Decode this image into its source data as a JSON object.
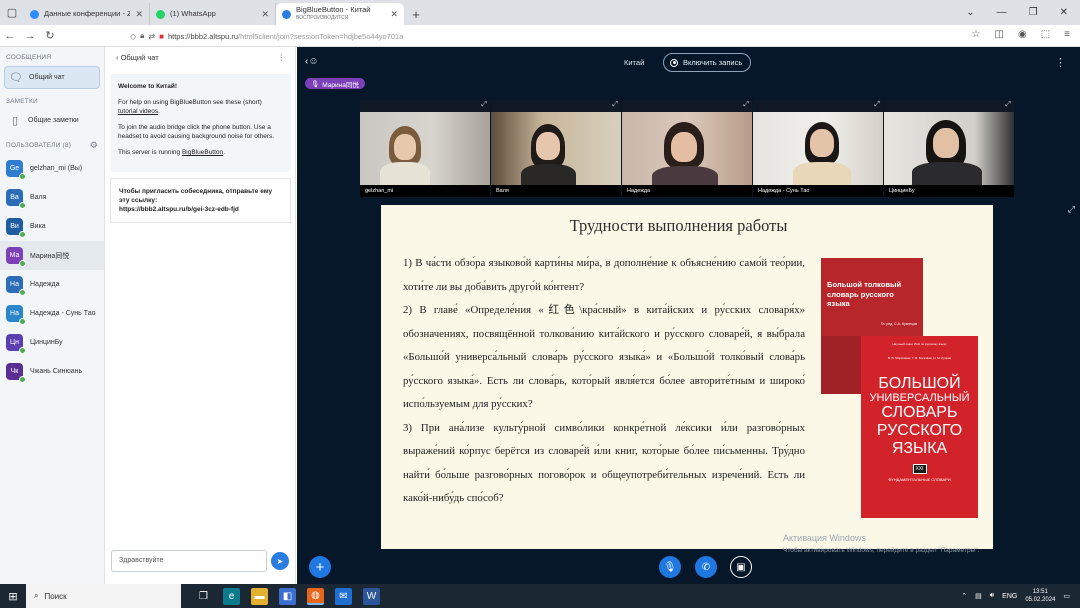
{
  "browser": {
    "tabs": [
      {
        "title": "Данные конференции - Zoom",
        "subtitle": "",
        "favicon_color": "#2d8cff"
      },
      {
        "title": "(1) WhatsApp",
        "subtitle": "",
        "favicon_color": "#25d366"
      },
      {
        "title": "BigBlueButton - Китай",
        "subtitle": "ВОСПРОИЗВОДИТСЯ",
        "favicon_color": "#2a7de1"
      }
    ],
    "url_host": "https://bbb2.altspu.ru",
    "url_path": "/html5client/join?sessionToken=hdjbe5o44yo701a"
  },
  "sidebar": {
    "messages_header": "СООБЩЕНИЯ",
    "public_chat": "Общий чат",
    "notes_header": "ЗАМЕТКИ",
    "shared_notes": "Общие заметки",
    "users_header": "ПОЛЬЗОВАТЕЛИ (8)",
    "users": [
      {
        "initials": "Ge",
        "name": "gelzhan_mi (Вы)",
        "color": "#2f7dd1",
        "me": false
      },
      {
        "initials": "Ва",
        "name": "Валя",
        "color": "#2c6db7",
        "me": false
      },
      {
        "initials": "Ви",
        "name": "Вика",
        "color": "#1f5d9e",
        "me": false
      },
      {
        "initials": "Ма",
        "name": "Марина同悦",
        "color": "#7b3fb8",
        "me": true
      },
      {
        "initials": "На",
        "name": "Надежда",
        "color": "#2c6db7",
        "me": false
      },
      {
        "initials": "На",
        "name": "Надежда - Сунь Тао",
        "color": "#2a86c8",
        "me": false
      },
      {
        "initials": "Цн",
        "name": "ЦинцинБу",
        "color": "#5a3fb0",
        "me": false
      },
      {
        "initials": "Чк",
        "name": "Чжань Синюань",
        "color": "#5b2f91",
        "me": false
      }
    ]
  },
  "chat": {
    "back_label": "Общий чат",
    "welcome_title": "Welcome to Китай!",
    "help_text_a": "For help on using BigBlueButton see these (short) ",
    "help_link": "tutorial videos",
    "help_text_b": ".",
    "audio_text": "To join the audio bridge click the phone button. Use a headset to avoid causing background noise for others.",
    "running_a": "This server is running ",
    "running_link": "BigBlueButton",
    "running_b": ".",
    "invite_text": "Чтобы пригласить собеседника, отправьте ему эту ссылку:",
    "invite_link": "https://bbb2.altspu.ru/b/gei-3cz-edb-fjd",
    "input_placeholder": "Здравствуйте"
  },
  "stage": {
    "room_name": "Китай",
    "record_label": "Включить запись",
    "talking": "Марина同悦",
    "videos": [
      {
        "name": "gelzhan_mi"
      },
      {
        "name": "Валя"
      },
      {
        "name": "Надежда"
      },
      {
        "name": "Надежда - Сунь Тао"
      },
      {
        "name": "ЦинцинБу"
      }
    ],
    "activation_title": "Активация Windows",
    "activation_text": "Чтобы активировать Windows, перейдите в раздел \"Параметры\"."
  },
  "slide": {
    "title": "Трудности выполнения работы",
    "paragraphs": [
      "1) В ча́сти обзо́ра языково́й карти́ны ми́ра, в дополне́ние к объясне́нию само́й тео́рии, хоти́те ли вы доба́вить друго́й ко́нтент?",
      "2) В главе́ «Определе́ния «红色\\кра́сный» в кита́йских и ру́сских словаря́х» обозначениях, посвящённой толкова́нию кита́йского и ру́сского словаре́й, я вы́брала «Большо́й универса́льный слова́рь ру́сского языка́» и «Большо́й толко́вый слова́рь ру́сского языка́». Есть ли слова́рь, кото́рый явля́ется бо́лее авторите́тным и широко́ испо́льзуемым для ру́сских?",
      "3) При ана́лизе культу́рной симво́лики конкре́тной ле́ксики и́ли разгово́рных выраже́ний ко́рпус берётся из словаре́й и́ли книг, кото́рые бо́лее пи́сьменны. Тру́дно найти́ бо́льше разгово́рных погово́рок и общеупотреби́тельных изрече́ний. Есть ли како́й-нибу́дь спо́соб?"
    ],
    "book1_title": "Большой толковый словарь русского языка",
    "book1_sub": "Гл. ред. С.А. Кузнецов",
    "book2_top": "Научный совет РАН по русскому языку",
    "book2_authors": "В. В. Морковкин, Г. Ф. Богачёва, Н. М. Луцкая",
    "book2_line1": "БОЛЬШОЙ",
    "book2_line2": "УНИВЕРСАЛЬНЫЙ",
    "book2_line3": "СЛОВАРЬ",
    "book2_line4": "РУССКОГО",
    "book2_line5": "ЯЗЫКА",
    "book2_badge": "XXI",
    "book2_foot": "ФУНДАМЕНТАЛЬНЫЕ СЛОВАРИ"
  },
  "taskbar": {
    "search_label": "Поиск",
    "lang": "ENG",
    "time": "13:51",
    "date": "05.02.2024"
  }
}
